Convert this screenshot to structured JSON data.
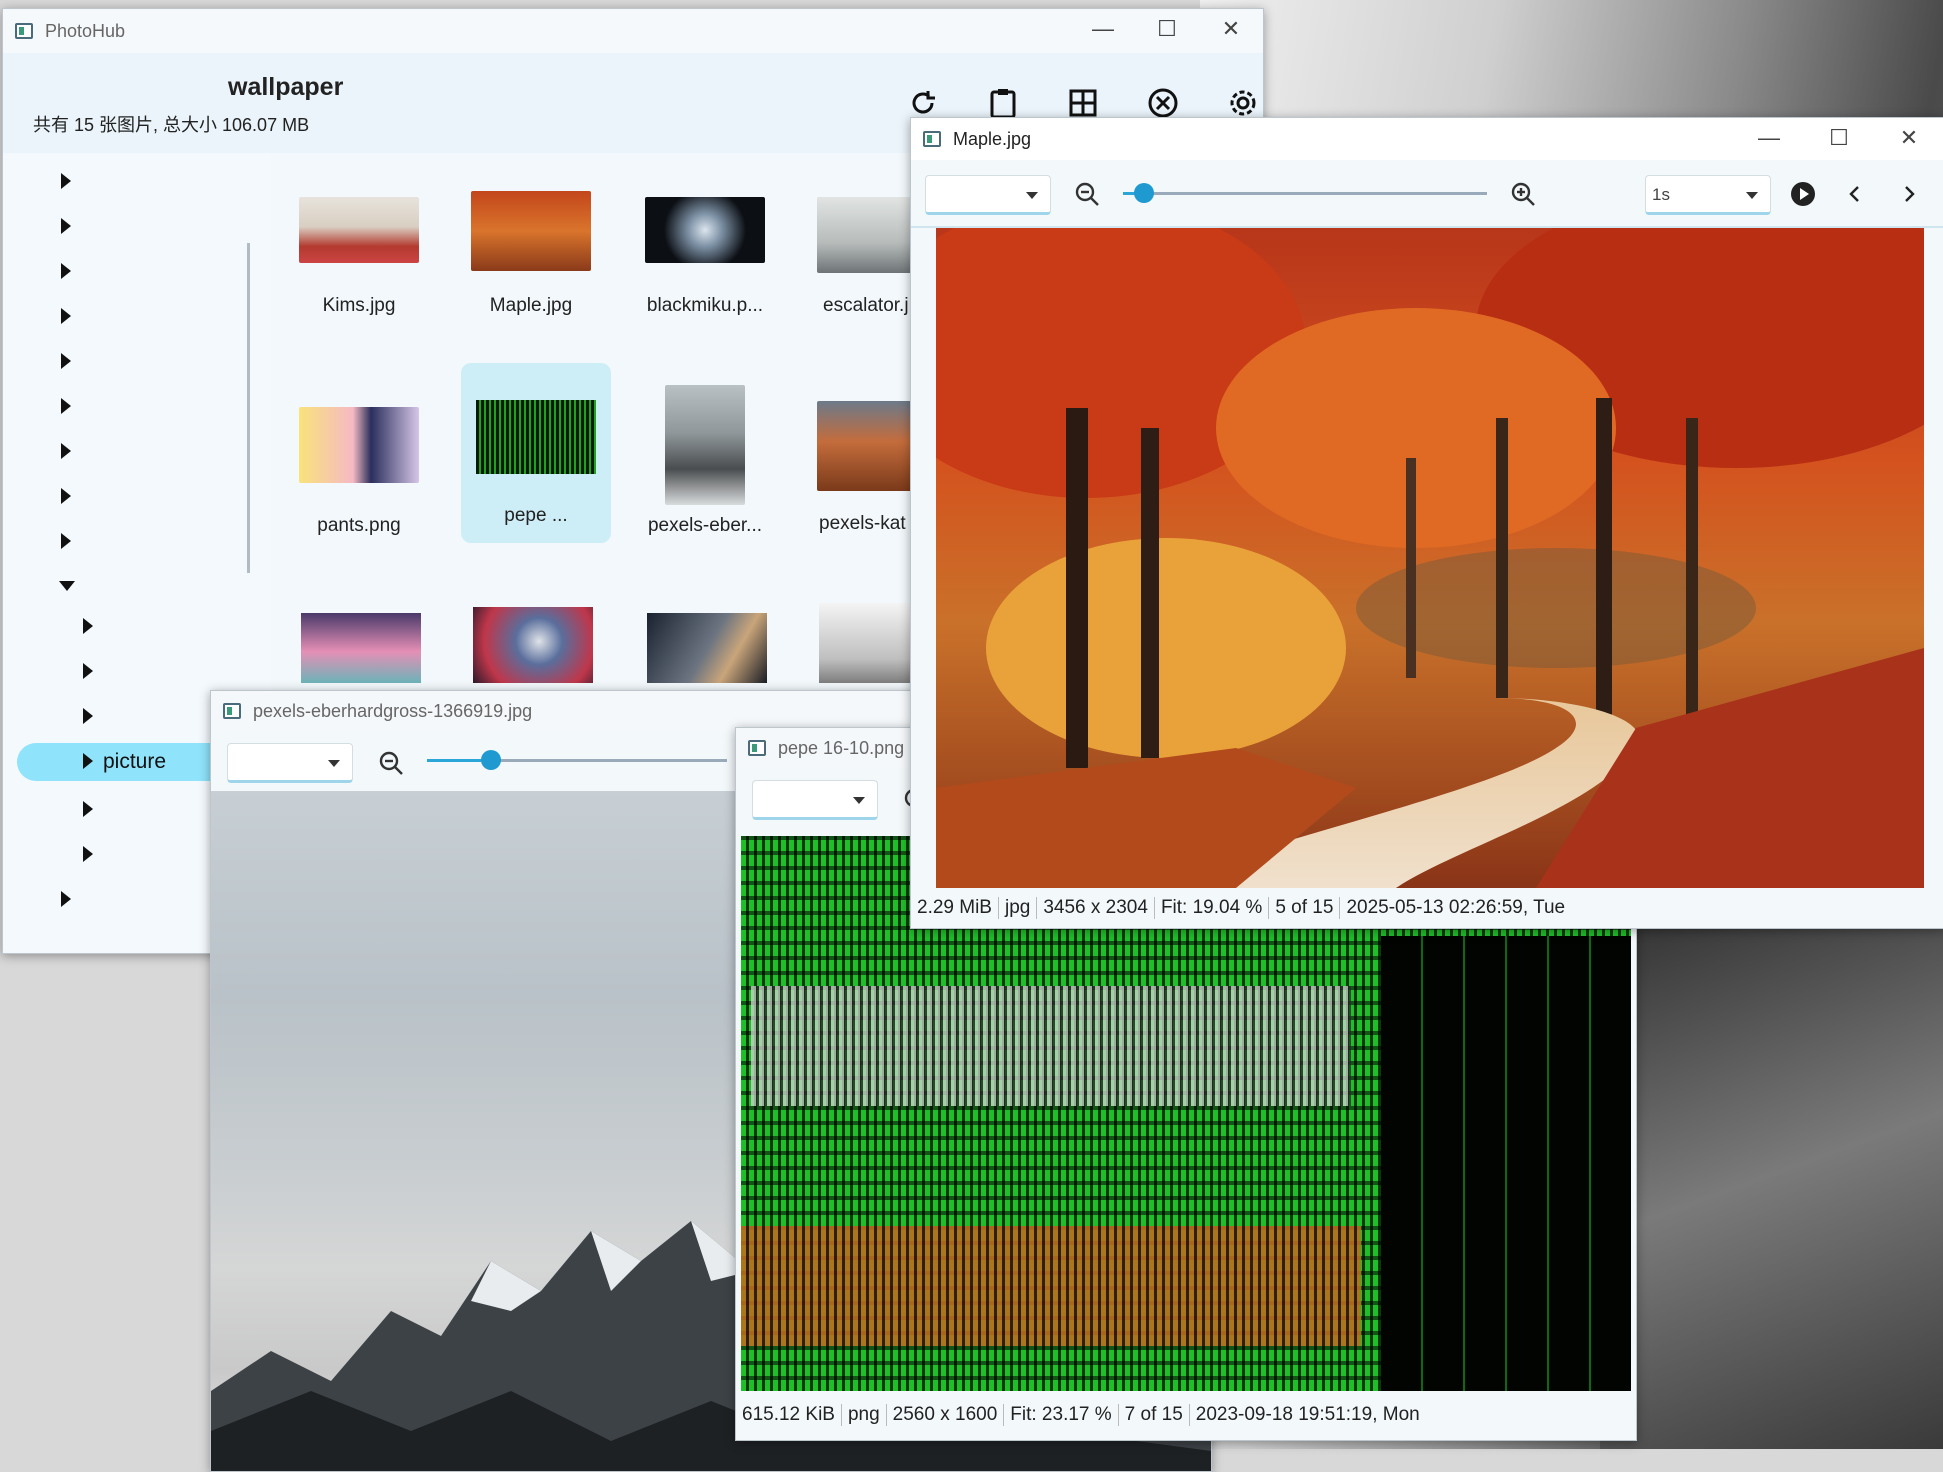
{
  "colors": {
    "accent": "#2aa6d8",
    "selection": "#cdeef7",
    "tree_selected": "#8fe3fb"
  },
  "main_window": {
    "title": "PhotoHub",
    "folder_name": "wallpaper",
    "summary": "共有 15 张图片, 总大小 106.07 MB",
    "toolbar_icons": [
      "refresh-icon",
      "clipboard-icon",
      "grid-icon",
      "close-circle-icon",
      "gear-icon"
    ],
    "thumbnails": [
      {
        "label": "Kims.jpg"
      },
      {
        "label": "Maple.jpg"
      },
      {
        "label": "blackmiku.p..."
      },
      {
        "label": "escalator.j"
      },
      {
        "label": "pants.png"
      },
      {
        "label": "pepe ..."
      },
      {
        "label": "pexels-eber..."
      },
      {
        "label": "pexels-kat"
      }
    ],
    "tree_selected_label": "picture"
  },
  "maple_window": {
    "title": "Maple.jpg",
    "interval": "1s",
    "zoom_fraction": 0.03,
    "status": [
      "2.29 MiB",
      "jpg",
      "3456 x 2304",
      "Fit: 19.04 %",
      "5 of 15",
      "2025-05-13 02:26:59, Tue"
    ]
  },
  "pexels_window": {
    "title": "pexels-eberhardgross-1366919.jpg",
    "zoom_fraction": 0.18
  },
  "pepe_window": {
    "title": "pepe 16-10.png",
    "status": [
      "615.12 KiB",
      "png",
      "2560 x 1600",
      "Fit: 23.17 %",
      "7 of 15",
      "2023-09-18 19:51:19, Mon"
    ]
  }
}
